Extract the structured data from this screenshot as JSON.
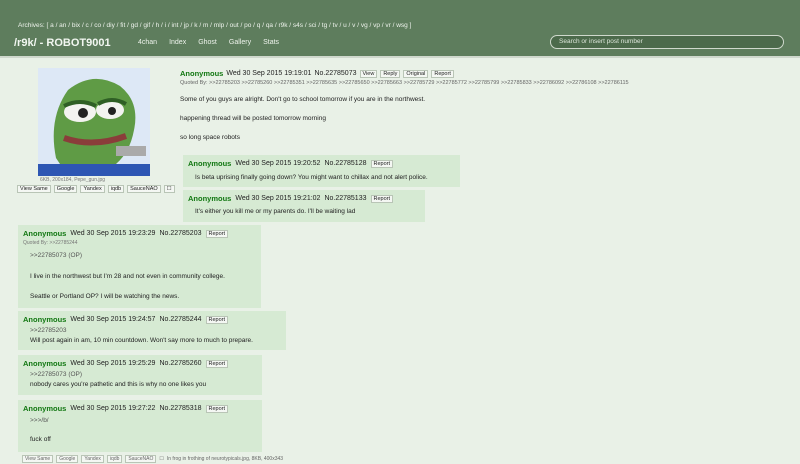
{
  "header": {
    "boards": "Archives: [ a / an / bix / c / co / diy / fit / gd / gif / h / i / int / jp / k / m / mlp / out / po / q / qa / r9k / s4s / sci / tg / tv / u / v / vg / vp / vr / wsg ]",
    "board_title": "/r9k/ - ROBOT9001",
    "nav": [
      "4chan",
      "Index",
      "Ghost",
      "Gallery",
      "Stats"
    ],
    "search_placeholder": "Search or insert post number"
  },
  "op": {
    "name": "Anonymous",
    "date": "Wed 30 Sep 2015 19:19:01",
    "num": "No.22785073",
    "buttons": [
      "View",
      "Reply",
      "Original",
      "Report"
    ],
    "quoted_by": "Quoted By: >>22785203 >>22785260 >>22785351 >>22785635 >>22785650 >>22785663 >>22785729 >>22785772 >>22785799 >>22785833 >>22786092 >>22786108 >>22786115",
    "image_caption": "6KB, 200x184, Pepe_gun.jpg",
    "image_tools": [
      "View Same",
      "Google",
      "Yandex",
      "iqdb",
      "SauceNAO",
      "☐"
    ],
    "lines": [
      "Some of you guys are alright. Don't go to school tomorrow if you are in the northwest.",
      "happening thread will be posted tomorrow morning",
      "so long space robots"
    ]
  },
  "replies": [
    {
      "name": "Anonymous",
      "date": "Wed 30 Sep 2015 19:20:52",
      "num": "No.22785128",
      "report": "Report",
      "lines": [
        "Is beta uprising finally going down? You might want to chillax and not alert police."
      ]
    },
    {
      "name": "Anonymous",
      "date": "Wed 30 Sep 2015 19:21:02",
      "num": "No.22785133",
      "report": "Report",
      "lines": [
        "It's either you kill me or my parents do. I'll be waiting lad"
      ]
    },
    {
      "name": "Anonymous",
      "date": "Wed 30 Sep 2015 19:23:29",
      "num": "No.22785203",
      "report": "Report",
      "quoted_by": "Quoted By: >>22785244",
      "lines": [
        ">>22785073 (OP)",
        "I live in the northwest but I'm 28 and not even in community college.",
        "Seattle or Portland OP? I will be watching the news."
      ]
    },
    {
      "name": "Anonymous",
      "date": "Wed 30 Sep 2015 19:24:57",
      "num": "No.22785244",
      "report": "Report",
      "lines": [
        ">>22785203",
        "Will post again in am, 10 min countdown. Won't say more to much to prepare."
      ]
    },
    {
      "name": "Anonymous",
      "date": "Wed 30 Sep 2015 19:25:29",
      "num": "No.22785260",
      "report": "Report",
      "lines": [
        ">>22785073 (OP)",
        "nobody cares you're pathetic and this is why no one likes you"
      ]
    },
    {
      "name": "Anonymous",
      "date": "Wed 30 Sep 2015 19:27:22",
      "num": "No.22785318",
      "report": "Report",
      "lines": [
        ">>>/b/",
        "fuck off"
      ]
    }
  ],
  "bottom_tools": {
    "buttons": [
      "View Same",
      "Google",
      "Yandex",
      "iqdb",
      "SauceNAO",
      "☐"
    ],
    "caption": "In frog in frothing of neurotypicals.jpg, 8KB, 400x343"
  },
  "colors": {
    "header": "#5e7d5d",
    "name": "#117711",
    "reply_bg": "#d6ead3",
    "page_bg": "#e9f1e7"
  }
}
